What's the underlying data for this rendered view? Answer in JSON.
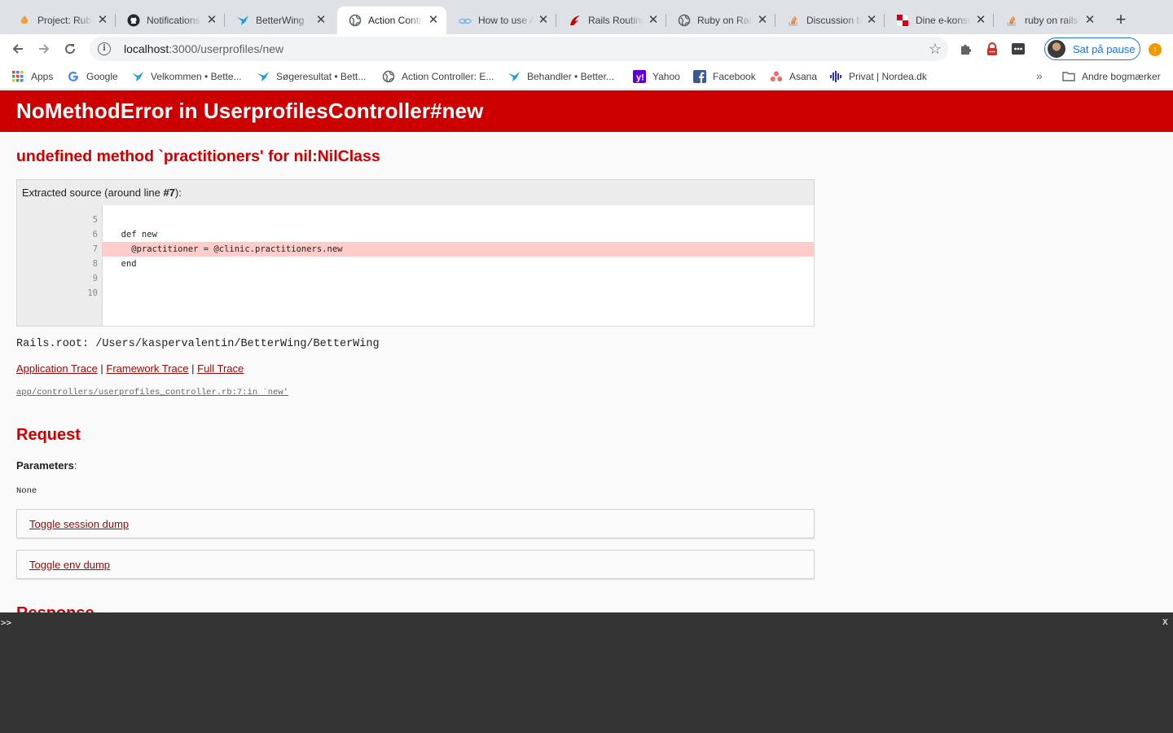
{
  "browser": {
    "tabs": [
      {
        "title": "Project: Ruby on Rails",
        "icon": "flame-icon"
      },
      {
        "title": "Notifications",
        "icon": "github-icon"
      },
      {
        "title": "BetterWing",
        "icon": "betterwing-icon"
      },
      {
        "title": "Action Controller",
        "icon": "globe-icon"
      },
      {
        "title": "How to use Action",
        "icon": "link-icon"
      },
      {
        "title": "Rails Routing from",
        "icon": "rails-icon"
      },
      {
        "title": "Ruby on Rails",
        "icon": "globe-icon"
      },
      {
        "title": "Discussion between",
        "icon": "stackoverflow-icon"
      },
      {
        "title": "Dine e-konsultationer",
        "icon": "red-square-icon"
      },
      {
        "title": "ruby on rails",
        "icon": "stackoverflow-icon"
      }
    ],
    "active_tab": 3,
    "url": {
      "host": "localhost",
      "path": ":3000/userprofiles/new"
    },
    "profile_label": "Sat på pause",
    "bookmarks": [
      {
        "label": "Apps",
        "icon": "apps-grid-icon"
      },
      {
        "label": "Google",
        "icon": "google-icon"
      },
      {
        "label": "Velkommen • Bette...",
        "icon": "betterwing-icon"
      },
      {
        "label": "Søgeresultat • Bett...",
        "icon": "betterwing-icon"
      },
      {
        "label": "Action Controller: E...",
        "icon": "globe-icon"
      },
      {
        "label": "Behandler • Better...",
        "icon": "betterwing-icon"
      },
      {
        "label": "Yahoo",
        "icon": "yahoo-icon"
      },
      {
        "label": "Facebook",
        "icon": "facebook-icon"
      },
      {
        "label": "Asana",
        "icon": "asana-icon"
      },
      {
        "label": "Privat | Nordea.dk",
        "icon": "nordea-icon"
      }
    ],
    "bookmarks_more": "»",
    "other_bookmarks": "Andre bogmærker"
  },
  "page": {
    "header": "NoMethodError in UserprofilesController#new",
    "message": "undefined method `practitioners' for nil:NilClass",
    "extract_caption_pre": "Extracted source (around line ",
    "extract_caption_line": "#7",
    "extract_caption_post": "):",
    "source_lines": [
      {
        "n": "5",
        "code": ""
      },
      {
        "n": "6",
        "code": "  def new"
      },
      {
        "n": "7",
        "code": "    @practitioner = @clinic.practitioners.new"
      },
      {
        "n": "8",
        "code": "  end"
      },
      {
        "n": "9",
        "code": ""
      },
      {
        "n": "10",
        "code": ""
      }
    ],
    "highlight_line": "7",
    "rails_root": "Rails.root: /Users/kaspervalentin/BetterWing/BetterWing",
    "traces": {
      "application": "Application Trace",
      "framework": "Framework Trace",
      "full": "Full Trace",
      "separator": "|"
    },
    "trace_line": "app/controllers/userprofiles_controller.rb:7:in `new'",
    "request_heading": "Request",
    "parameters_label": "Parameters",
    "parameters_value": "None",
    "toggle_session": "Toggle session dump",
    "toggle_env": "Toggle env dump",
    "response_heading": "Response"
  },
  "console": {
    "prompt": ">>",
    "close": "x"
  },
  "colors": {
    "error_red": "#cc0000",
    "link_red": "#980905",
    "highlight": "#ffcccc",
    "console_bg": "#333333"
  }
}
